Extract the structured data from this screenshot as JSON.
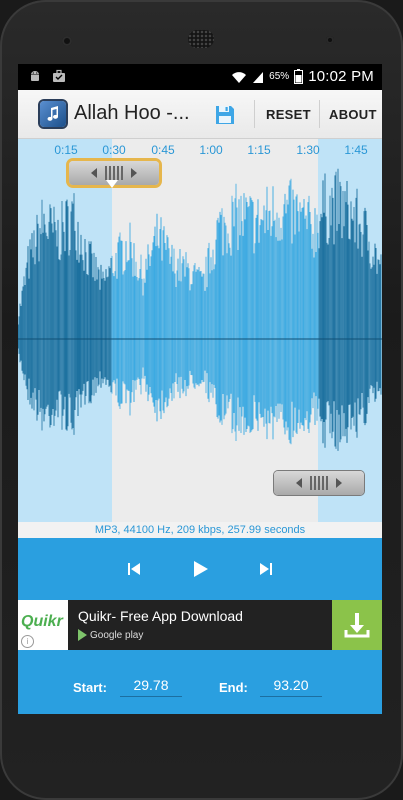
{
  "status_bar": {
    "battery": "65%",
    "time": "10:02 PM",
    "icons": [
      "android-icon",
      "briefcase-icon",
      "wifi-icon",
      "signal-icon",
      "battery-icon"
    ]
  },
  "action_bar": {
    "app_title": "Allah Hoo -...",
    "reset_label": "RESET",
    "about_label": "ABOUT",
    "icons": [
      "app-icon",
      "save-icon"
    ]
  },
  "timeline": {
    "ticks": [
      "0:15",
      "0:30",
      "0:45",
      "1:00",
      "1:15",
      "1:30",
      "1:45"
    ]
  },
  "waveform": {
    "selection_start_seconds": 29.78,
    "selection_end_seconds": 93.2,
    "duration_seconds": 257.99
  },
  "file_info": "MP3, 44100 Hz, 209 kbps, 257.99 seconds",
  "transport": {
    "icons": [
      "skip-previous-icon",
      "play-icon",
      "skip-next-icon"
    ]
  },
  "ad": {
    "logo_text": "Quikr",
    "title": "Quikr- Free App Download",
    "store": "Google play",
    "icons": [
      "info-icon",
      "download-icon"
    ]
  },
  "range": {
    "start_label": "Start:",
    "start_value": "29.78",
    "end_label": "End:",
    "end_value": "93.20"
  },
  "colors": {
    "accent": "#2a9fe0",
    "waveform_dark": "#1a6f9e",
    "waveform_light": "#3aa9e2",
    "unselected_bg": "#bfe3f7",
    "handle_highlight": "#e6b64c"
  }
}
